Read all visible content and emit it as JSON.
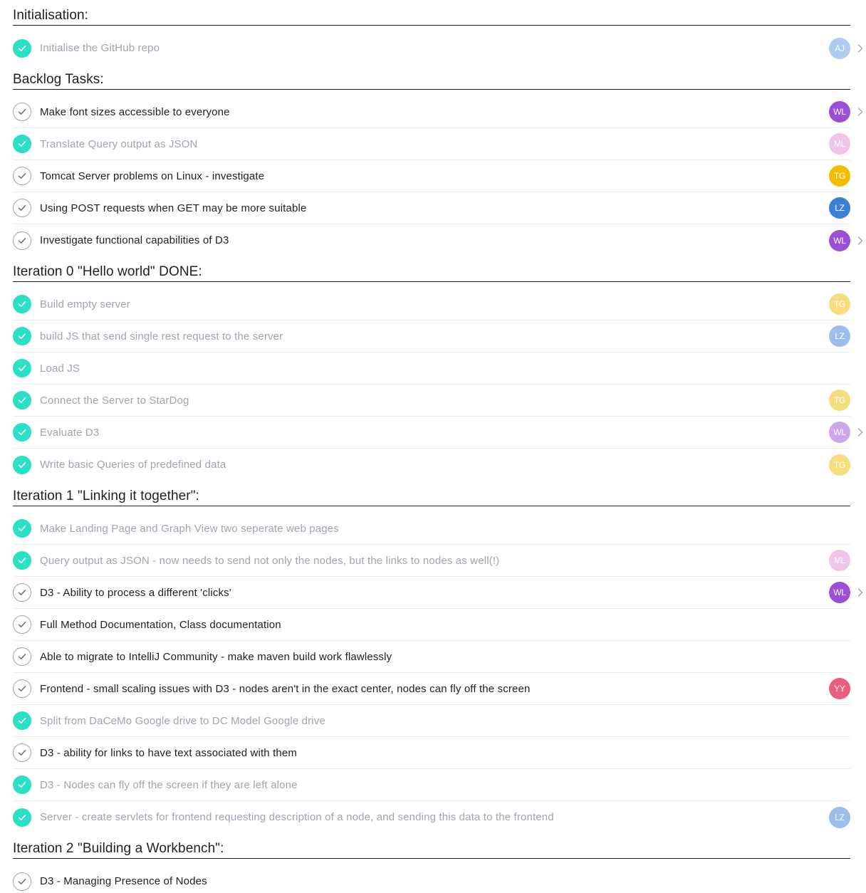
{
  "colors": {
    "check_done": "#2ce0c6",
    "check_open_border": "#9ca6af",
    "text_active": "#1e1f21",
    "text_completed": "#9ca6af",
    "divider": "#e8ecee",
    "avatar_AJ": "#5b9be6",
    "avatar_WL": "#9b4fd5",
    "avatar_ML": "#e88ad8",
    "avatar_TG": "#f1bd00",
    "avatar_LZ": "#3c7fd6",
    "avatar_YY": "#ea5f7e"
  },
  "icons": {
    "check": "check-icon",
    "chevron": "chevron-right-icon"
  },
  "sections": [
    {
      "title": "Initialisation:",
      "tasks": [
        {
          "name": "Initialise the GitHub repo",
          "completed": true,
          "assignee": "AJ",
          "chevron": true
        }
      ]
    },
    {
      "title": "Backlog Tasks:",
      "tasks": [
        {
          "name": "Make font sizes accessible to everyone",
          "completed": false,
          "assignee": "WL",
          "chevron": true
        },
        {
          "name": "Translate Query output as JSON",
          "completed": true,
          "assignee": "ML",
          "chevron": false
        },
        {
          "name": "Tomcat Server problems on Linux - investigate",
          "completed": false,
          "assignee": "TG",
          "chevron": false
        },
        {
          "name": "Using POST requests when GET may be more suitable",
          "completed": false,
          "assignee": "LZ",
          "chevron": false
        },
        {
          "name": "Investigate functional capabilities of D3",
          "completed": false,
          "assignee": "WL",
          "chevron": true
        }
      ]
    },
    {
      "title": "Iteration 0 \"Hello world\" DONE:",
      "tasks": [
        {
          "name": "Build empty server",
          "completed": true,
          "assignee": "TG",
          "chevron": false
        },
        {
          "name": "build JS that send single rest request to the server",
          "completed": true,
          "assignee": "LZ",
          "chevron": false
        },
        {
          "name": "Load JS",
          "completed": true,
          "assignee": "",
          "chevron": false
        },
        {
          "name": "Connect the Server to StarDog",
          "completed": true,
          "assignee": "TG",
          "chevron": false
        },
        {
          "name": "Evaluate D3",
          "completed": true,
          "assignee": "WL",
          "chevron": true
        },
        {
          "name": "Write basic Queries of predefined data",
          "completed": true,
          "assignee": "TG",
          "chevron": false
        }
      ]
    },
    {
      "title": "Iteration 1 \"Linking it together\":",
      "tasks": [
        {
          "name": "Make Landing Page and Graph View two seperate web pages",
          "completed": true,
          "assignee": "",
          "chevron": false
        },
        {
          "name": "Query output as JSON - now needs to send not only the nodes, but the links to nodes as well(!)",
          "completed": true,
          "assignee": "ML",
          "chevron": false
        },
        {
          "name": "D3 - Ability to process a different 'clicks'",
          "completed": false,
          "assignee": "WL",
          "chevron": true
        },
        {
          "name": "Full Method Documentation, Class documentation",
          "completed": false,
          "assignee": "",
          "chevron": false
        },
        {
          "name": "Able to migrate to IntelliJ Community - make maven build work flawlessly",
          "completed": false,
          "assignee": "",
          "chevron": false
        },
        {
          "name": "Frontend - small scaling issues with D3 - nodes aren't in the exact center, nodes can fly off the screen",
          "completed": false,
          "assignee": "YY",
          "chevron": false
        },
        {
          "name": "Split from DaCeMo Google drive to DC Model Google drive",
          "completed": true,
          "assignee": "",
          "chevron": false
        },
        {
          "name": "D3 - ability for links to have text associated with them",
          "completed": false,
          "assignee": "",
          "chevron": false
        },
        {
          "name": "D3 - Nodes can fly off the screen if they are left alone",
          "completed": true,
          "assignee": "",
          "chevron": false
        },
        {
          "name": "Server - create servlets for frontend requesting description of a node, and sending this data to the frontend",
          "completed": true,
          "assignee": "LZ",
          "chevron": false
        }
      ]
    },
    {
      "title": "Iteration 2 \"Building a Workbench\":",
      "tasks": [
        {
          "name": "D3 - Managing Presence of Nodes",
          "completed": false,
          "assignee": "",
          "chevron": false
        }
      ]
    }
  ]
}
